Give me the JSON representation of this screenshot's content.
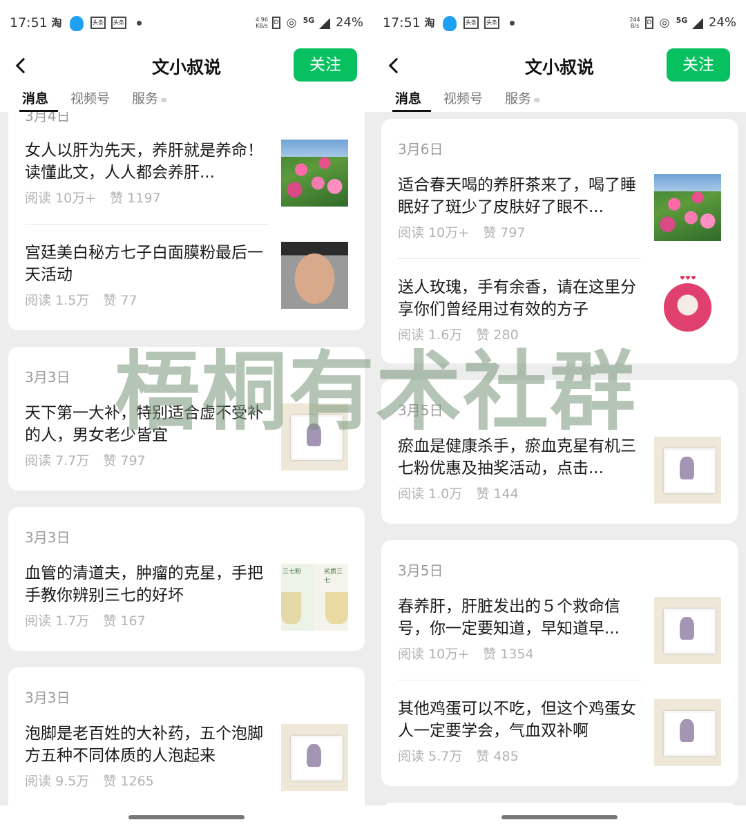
{
  "status": {
    "time": "17:51",
    "left_icons": [
      "taobao-icon",
      "qq-icon",
      "toutiao-icon",
      "toutiao-icon",
      "dot-icon"
    ],
    "tao_label": "淘",
    "toutiao_label": "头条",
    "speed_left": "4.96 KB/s",
    "speed_right": "244 B/s",
    "network": "5G",
    "battery": "24%"
  },
  "header": {
    "title": "文小叔说",
    "follow_label": "关注",
    "accent_color": "#07c160"
  },
  "tabs": [
    {
      "label": "消息"
    },
    {
      "label": "视频号"
    },
    {
      "label": "服务"
    }
  ],
  "tab_menu_glyph": "≡",
  "labels": {
    "read_prefix": "阅读",
    "like_prefix": "赞"
  },
  "left_feed": {
    "cards": [
      {
        "date": "3月4日",
        "articles": [
          {
            "title": "女人以肝为先天，养肝就是养命！读懂此文，人人都会养肝...",
            "reads": "10万+",
            "likes": "1197",
            "thumb": "flowers"
          },
          {
            "title": "宫廷美白秘方七子白面膜粉最后一天活动",
            "reads": "1.5万",
            "likes": "77",
            "thumb": "face"
          }
        ]
      },
      {
        "date": "3月3日",
        "articles": [
          {
            "title": "天下第一大补，特别适合虚不受补的人，男女老少皆宜",
            "reads": "7.7万",
            "likes": "797",
            "thumb": "frame"
          }
        ]
      },
      {
        "date": "3月3日",
        "articles": [
          {
            "title": "血管的清道夫，肿瘤的克星，手把手教你辨别三七的好坏",
            "reads": "1.7万",
            "likes": "167",
            "thumb": "cups",
            "thumb_text_left": "三七粉",
            "thumb_text_right": "劣质三七"
          }
        ]
      },
      {
        "date": "3月3日",
        "articles": [
          {
            "title": "泡脚是老百姓的大补药，五个泡脚方五种不同体质的人泡起来",
            "reads": "9.5万",
            "likes": "1265",
            "thumb": "frame"
          }
        ]
      }
    ]
  },
  "right_feed": {
    "cards": [
      {
        "date": "3月6日",
        "articles": [
          {
            "title": "适合春天喝的养肝茶来了，喝了睡眠好了斑少了皮肤好了眼不...",
            "reads": "10万+",
            "likes": "797",
            "thumb": "flowers"
          },
          {
            "title": "送人玫瑰，手有余香，请在这里分享你们曾经用过有效的方子",
            "reads": "1.6万",
            "likes": "280",
            "thumb": "rose"
          }
        ]
      },
      {
        "date": "3月5日",
        "articles": [
          {
            "title": "瘀血是健康杀手，瘀血克星有机三七粉优惠及抽奖活动，点击...",
            "reads": "1.0万",
            "likes": "144",
            "thumb": "frame"
          }
        ]
      },
      {
        "date": "3月5日",
        "articles": [
          {
            "title": "春养肝，肝脏发出的５个救命信号，你一定要知道，早知道早...",
            "reads": "10万+",
            "likes": "1354",
            "thumb": "frame"
          },
          {
            "title": "其他鸡蛋可以不吃，但这个鸡蛋女人一定要学会，气血双补啊",
            "reads": "5.7万",
            "likes": "485",
            "thumb": "frame"
          }
        ]
      }
    ]
  },
  "watermark": "梧桐有术社群"
}
